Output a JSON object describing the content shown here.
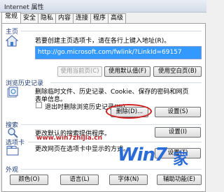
{
  "window": {
    "title": "Internet 属性"
  },
  "tabs": [
    "常规",
    "安全",
    "隐私",
    "内容",
    "连接",
    "程序",
    "高级"
  ],
  "home": {
    "section": "主页",
    "description": "若要创建主页选项卡，请在各行上键入地址(R)。",
    "url": "http://go.microsoft.com/fwlink/?LinkId=69157",
    "buttons": {
      "current": "使用当前页(C)",
      "default": "使用默认值(F)",
      "blank": "使用空白页(B)"
    }
  },
  "history": {
    "section": "浏览历史记录",
    "description_line1": "删除临时文件、历史记录、Cookie、保存的密码和网页",
    "description_line2": "表单信息。",
    "checkbox_label": "退出时删除浏览历史记录(W)",
    "buttons": {
      "delete": "删除(D)...",
      "settings": "设置(S)"
    }
  },
  "search": {
    "section": "搜索",
    "description": "更改默认的搜索提供程序。",
    "settings": "设置(I)"
  },
  "tabs_section": {
    "section": "选项卡",
    "description": "更改网页在选项卡中显示的方式。",
    "settings": "设置(T)"
  },
  "appearance": {
    "section": "外观",
    "buttons": {
      "colors": "颜色(O)",
      "languages": "语言(L)",
      "fonts": "字体(N)",
      "accessibility": "辅助功能(E)"
    }
  },
  "watermark": {
    "url": "www.win7zhijia.cn",
    "brand": "Win7",
    "brand_suffix": "家"
  },
  "colors": {
    "highlight": "#3399ff",
    "annotation_ring": "#d21c1c"
  }
}
